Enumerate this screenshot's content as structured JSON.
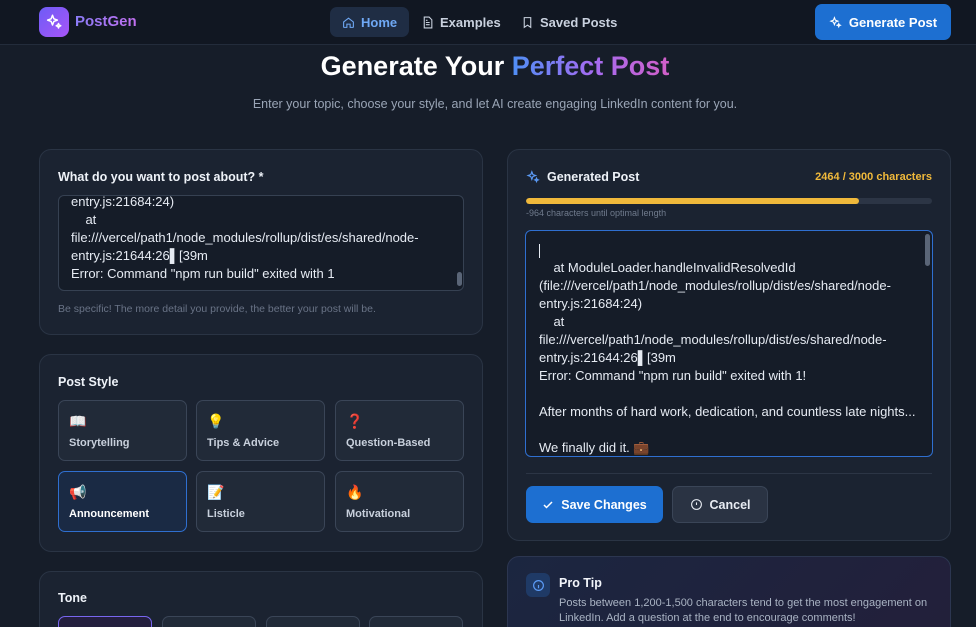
{
  "nav": {
    "brand": "PostGen",
    "links": [
      {
        "label": "Home",
        "active": true
      },
      {
        "label": "Examples",
        "active": false
      },
      {
        "label": "Saved Posts",
        "active": false
      }
    ],
    "cta": "Generate Post"
  },
  "hero": {
    "title_plain": "Generate Your ",
    "title_accent": "Perfect Post",
    "subtitle": "Enter your topic, choose your style, and let AI create engaging LinkedIn content for you."
  },
  "topic": {
    "label": "What do you want to post about? *",
    "lines": [
      "entry.js:21684:24)",
      "    at",
      "file:///vercel/path1/node_modules/rollup/dist/es/shared/node-",
      "entry.js:21644:26▌[39m",
      "Error: Command \"npm run build\" exited with 1"
    ],
    "helper": "Be specific! The more detail you provide, the better your post will be."
  },
  "style": {
    "label": "Post Style",
    "options": [
      {
        "emoji": "📖",
        "name": "Storytelling",
        "selected": false
      },
      {
        "emoji": "💡",
        "name": "Tips & Advice",
        "selected": false
      },
      {
        "emoji": "❓",
        "name": "Question-Based",
        "selected": false
      },
      {
        "emoji": "📢",
        "name": "Announcement",
        "selected": true
      },
      {
        "emoji": "📝",
        "name": "Listicle",
        "selected": false
      },
      {
        "emoji": "🔥",
        "name": "Motivational",
        "selected": false
      }
    ]
  },
  "tone": {
    "label": "Tone"
  },
  "generated": {
    "label": "Generated Post",
    "char_count": "2464 / 3000 characters",
    "progress": 0.8213,
    "hint": "-964 characters until optimal length",
    "lines": [
      "",
      "    at ModuleLoader.handleInvalidResolvedId",
      "(file:///vercel/path1/node_modules/rollup/dist/es/shared/node-",
      "entry.js:21684:24)",
      "    at",
      "file:///vercel/path1/node_modules/rollup/dist/es/shared/node-",
      "entry.js:21644:26▌[39m",
      "Error: Command \"npm run build\" exited with 1!",
      "",
      "After months of hard work, dedication, and countless late nights...",
      "",
      "We finally did it. 💼"
    ],
    "save": "Save Changes",
    "cancel": "Cancel"
  },
  "tip": {
    "title": "Pro Tip",
    "body": "Posts between 1,200-1,500 characters tend to get the most engagement on LinkedIn. Add a question at the end to encourage comments!"
  },
  "colors": {
    "accent": "#1d6fd1",
    "warning": "#f0b93b",
    "brand": "#7c6cf7"
  }
}
